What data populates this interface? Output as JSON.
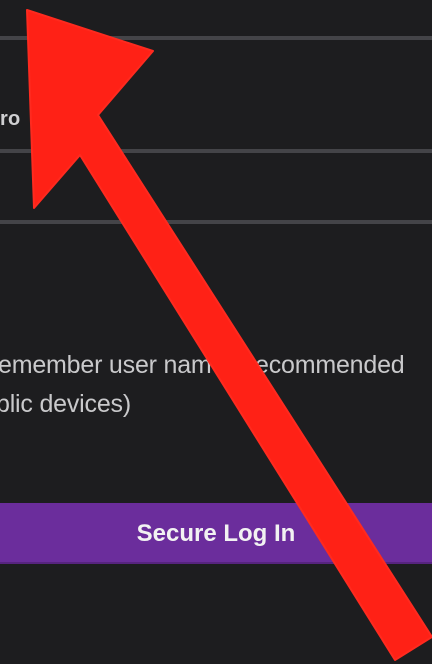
{
  "form": {
    "password_label_fragment": "ro",
    "remember_text_line_1": "emember user name (  recommended",
    "remember_text_line_2": "blic devices)",
    "secure_login_label": "Secure Log In"
  },
  "colors": {
    "background": "#1d1d1f",
    "button": "#6b2d9c",
    "arrow": "#ff2116"
  },
  "annotation": {
    "icon": "red-arrow-icon"
  }
}
